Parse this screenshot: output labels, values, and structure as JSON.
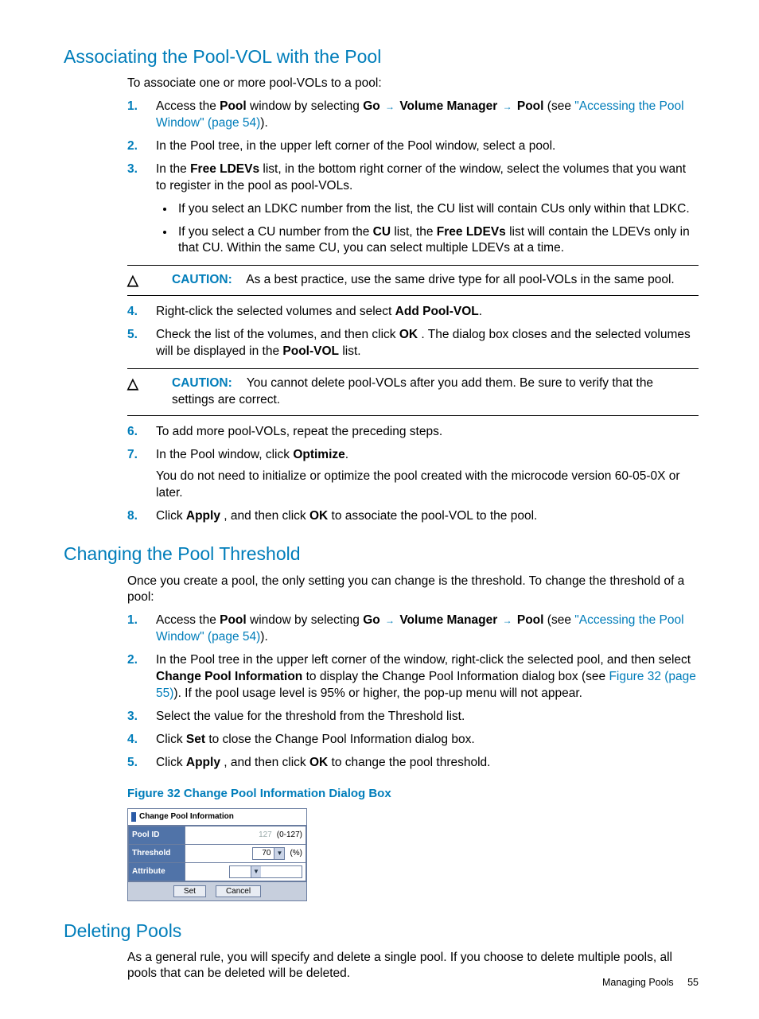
{
  "section1": {
    "title": "Associating the Pool-VOL with the Pool",
    "intro": "To associate one or more pool-VOLs to a pool:",
    "step1_pre": "Access the ",
    "step1_pool": "Pool",
    "step1_mid1": " window by selecting ",
    "step1_go": "Go",
    "step1_vm": "Volume Manager",
    "step1_poolmenu": "Pool",
    "step1_see": " (see ",
    "step1_link": "\"Accessing the Pool Window\" (page 54)",
    "step1_end": ").",
    "step2": "In the Pool tree, in the upper left corner of the Pool window, select a pool.",
    "step3_pre": "In the ",
    "step3_bold": "Free LDEVs",
    "step3_post": " list, in the bottom right corner of the window, select the volumes that you want to register in the pool as pool-VOLs.",
    "bullet1": "If you select an LDKC number from the list, the CU list will contain CUs only within that LDKC.",
    "bullet2_pre": "If you select a CU number from the ",
    "bullet2_cu": "CU",
    "bullet2_mid": " list, the ",
    "bullet2_fl": "Free LDEVs",
    "bullet2_post": " list will contain the LDEVs only in that CU. Within the same CU, you can select multiple LDEVs at a time.",
    "caution1_label": "CAUTION:",
    "caution1": "As a best practice, use the same drive type for all pool-VOLs in the same pool.",
    "step4_pre": "Right-click the selected volumes and select ",
    "step4_bold": "Add Pool-VOL",
    "step4_post": ".",
    "step5_pre": "Check the list of the volumes, and then click ",
    "step5_ok": "OK",
    "step5_mid": ". The dialog box closes and the selected volumes will be displayed in the ",
    "step5_pvol": "Pool-VOL",
    "step5_post": " list.",
    "caution2_label": "CAUTION:",
    "caution2": "You cannot delete pool-VOLs after you add them. Be sure to verify that the settings are correct.",
    "step6": "To add more pool-VOLs, repeat the preceding steps.",
    "step7_pre": "In the Pool window, click ",
    "step7_bold": "Optimize",
    "step7_post": ".",
    "step7_note": "You do not need to initialize or optimize the pool created with the microcode version 60-05-0X or later.",
    "step8_pre": "Click ",
    "step8_apply": "Apply",
    "step8_mid": ", and then click ",
    "step8_ok": "OK",
    "step8_post": " to associate the pool-VOL to the pool."
  },
  "section2": {
    "title": "Changing the Pool Threshold",
    "intro": "Once you create a pool, the only setting you can change is the threshold. To change the threshold of a pool:",
    "step1_pre": "Access the ",
    "step1_pool": "Pool",
    "step1_mid1": " window by selecting ",
    "step1_go": "Go",
    "step1_vm": "Volume Manager",
    "step1_poolmenu": "Pool",
    "step1_see": " (see ",
    "step1_link": "\"Accessing the Pool Window\" (page 54)",
    "step1_end": ").",
    "step2_pre": "In the Pool tree in the upper left corner of the window, right-click the selected pool, and then select ",
    "step2_bold": "Change Pool Information",
    "step2_mid": " to display the Change Pool Information dialog box (see ",
    "step2_link": "Figure 32 (page 55)",
    "step2_post": "). If the pool usage level is 95% or higher, the pop-up menu will not appear.",
    "step3": "Select the value for the threshold from the Threshold list.",
    "step4_pre": "Click ",
    "step4_bold": "Set",
    "step4_post": " to close the Change Pool Information dialog box.",
    "step5_pre": "Click ",
    "step5_apply": "Apply",
    "step5_mid": ", and then click ",
    "step5_ok": "OK",
    "step5_post": " to change the pool threshold.",
    "figcaption": "Figure 32 Change Pool Information Dialog Box"
  },
  "dialog": {
    "title": "Change Pool Information",
    "rows": {
      "poolid_label": "Pool ID",
      "poolid_value": "127",
      "poolid_range": "(0-127)",
      "threshold_label": "Threshold",
      "threshold_value": "70",
      "threshold_unit": "(%)",
      "attribute_label": "Attribute",
      "attribute_value": ""
    },
    "set": "Set",
    "cancel": "Cancel"
  },
  "section3": {
    "title": "Deleting Pools",
    "body": "As a general rule, you will specify and delete a single pool. If you choose to delete multiple pools, all pools that can be deleted will be deleted."
  },
  "footer": {
    "text": "Managing Pools",
    "page": "55"
  }
}
